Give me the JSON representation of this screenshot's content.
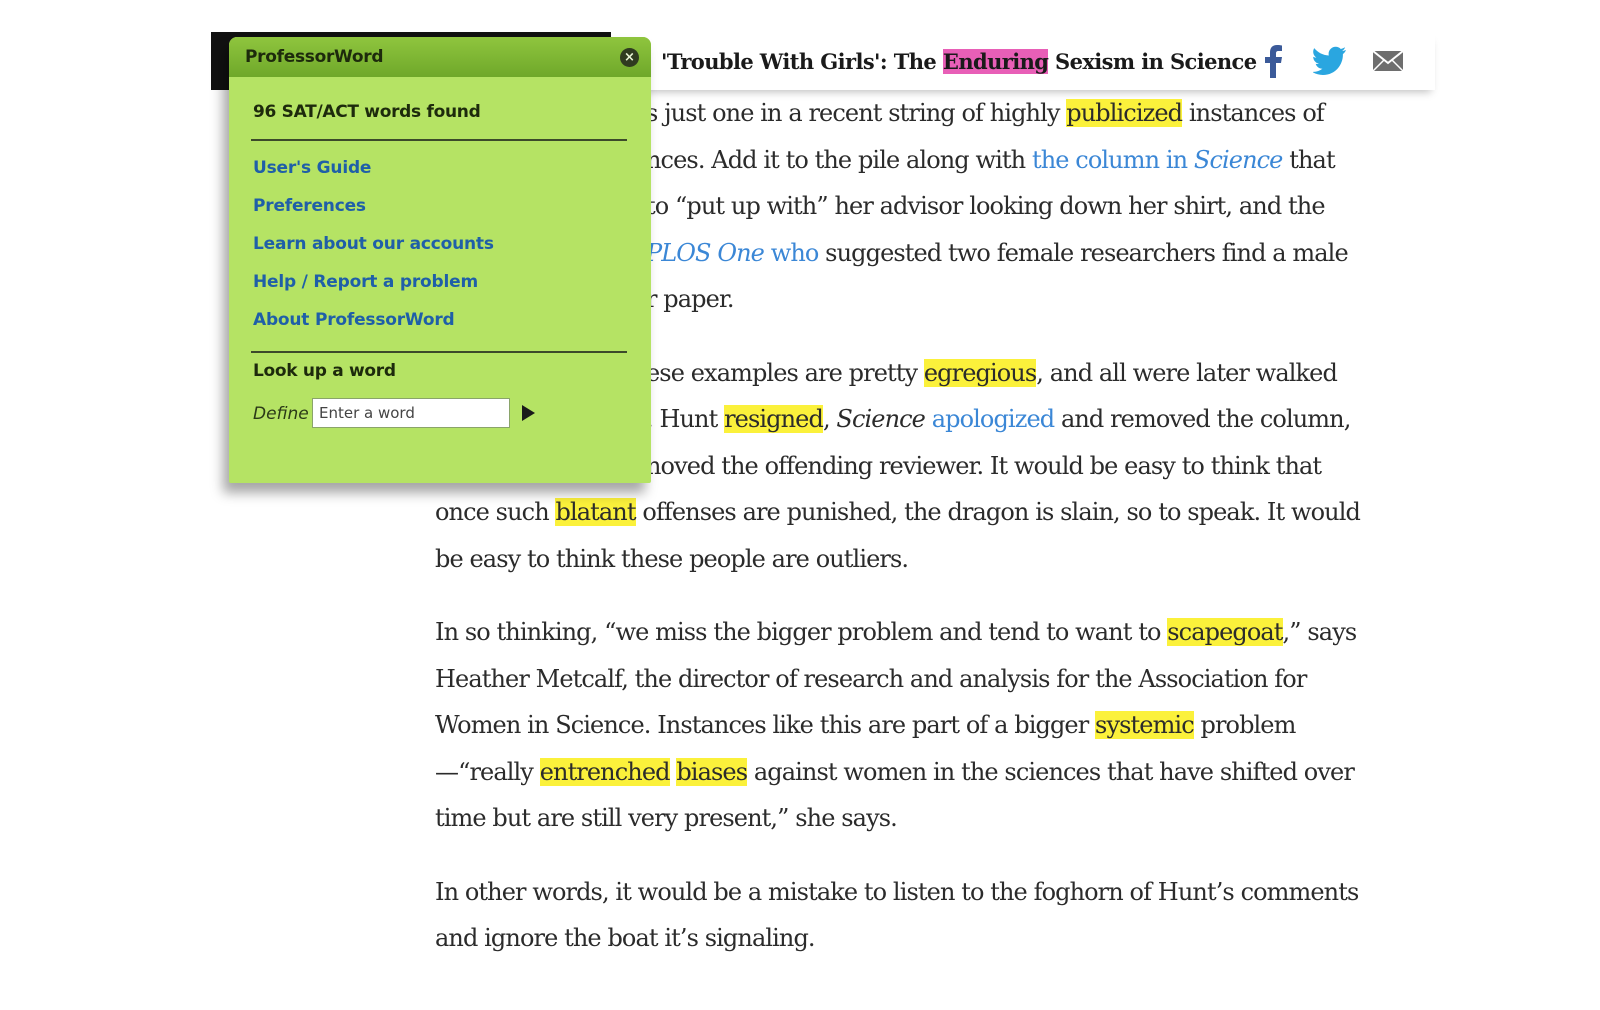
{
  "header": {
    "title_pre": "'Trouble With Girls': The ",
    "title_highlight": "Enduring",
    "title_post": " Sexism in Science",
    "share": [
      "facebook-icon",
      "twitter-icon",
      "mail-icon"
    ]
  },
  "article": {
    "p1": {
      "l1_a": "s just one in a recent string of highly ",
      "l1_hl": "publicized",
      "l1_b": " instances of",
      "l2_a": "nces. Add it to the pile along with ",
      "l2_link1": "the column in ",
      "l2_link2": "Science",
      "l2_b": " that",
      "l3": "to “put up with” her advisor looking down her shirt, and the",
      "l4_link1": "PLOS One",
      "l4_link2": " who",
      "l4_b": " suggested two female researchers find a male",
      "l5": "r paper."
    },
    "p2": {
      "l1_a": "ese examples are pretty ",
      "l1_hl": "egregious",
      "l1_b": ", and all were later walked",
      "l2_a": ". Hunt ",
      "l2_hl": "resigned",
      "l2_b": ", ",
      "l2_em": "Science",
      "l2_sp": " ",
      "l2_link": "apologized",
      "l2_c": " and removed the column,",
      "l3": "noved the offending reviewer. It would be easy to think that",
      "l4_a": "once such ",
      "l4_hl": "blatant",
      "l4_b": " offenses are punished, the dragon is slain, so to speak. It would",
      "l5": "be easy to think these people are outliers."
    },
    "p3": {
      "l1_a": "In so thinking, “we miss the bigger problem and tend to want to ",
      "l1_hl": "scapegoat",
      "l1_b": ",” says",
      "l2": "Heather Metcalf, the director of research and analysis for the Association for",
      "l3_a": "Women in Science. Instances like this are part of a bigger ",
      "l3_hl": "systemic",
      "l3_b": " problem",
      "l4_a": "—“really ",
      "l4_hl1": "entrenched",
      "l4_sp": " ",
      "l4_hl2": "biases",
      "l4_b": " against women in the sciences that have shifted over",
      "l5": "time but are still very present,” she says."
    },
    "p4": {
      "l1": "In other words, it would be a mistake to listen to the foghorn of Hunt’s comments",
      "l2": "and ignore the boat it’s signaling."
    }
  },
  "popup": {
    "title": "ProfessorWord",
    "close_icon": "×",
    "found": "96 SAT/ACT words found",
    "links": [
      "User's Guide",
      "Preferences",
      "Learn about our accounts",
      "Help / Report a problem",
      "About ProfessorWord"
    ],
    "lookup_label": "Look up a word",
    "define_label": "Define",
    "input_placeholder": "Enter a word"
  },
  "colors": {
    "popup_bg": "#b5e364",
    "highlight_yellow": "#fbf13b",
    "highlight_pink": "#e85fb7",
    "link_blue": "#3b87d6"
  }
}
